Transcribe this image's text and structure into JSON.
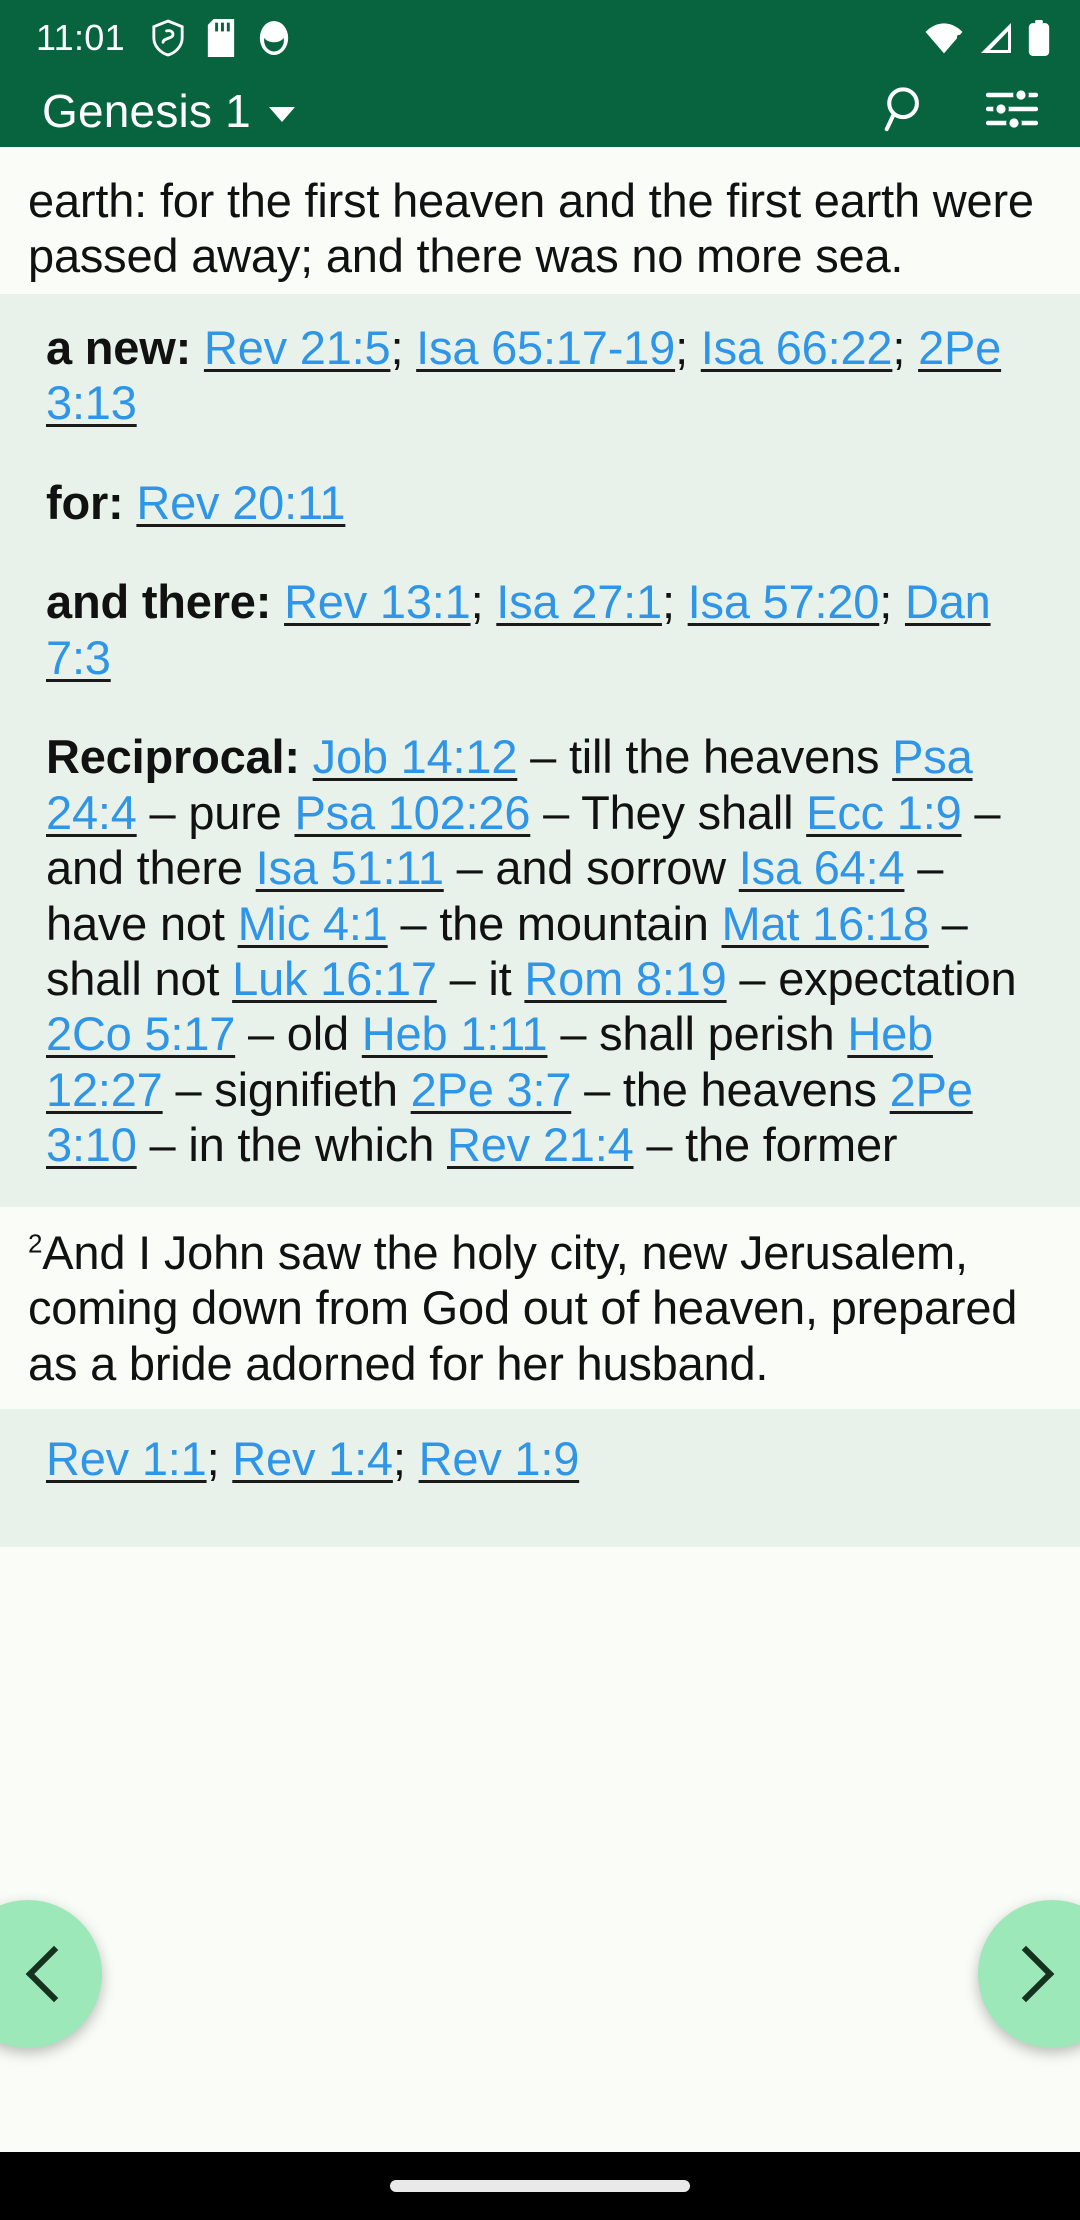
{
  "status_bar": {
    "time": "11:01",
    "left_icons": [
      "shield-vpn-icon",
      "sd-card-icon",
      "app-badge-icon"
    ],
    "right_icons": [
      "wifi-icon",
      "cellular-signal-icon",
      "battery-icon"
    ],
    "background_color": "#07643f",
    "foreground_color": "#ffffff"
  },
  "app_bar": {
    "title": "Genesis 1",
    "dropdown_icon": "chevron-down-icon",
    "search_icon": "search-icon",
    "settings_icon": "sliders-icon",
    "background_color": "#07643f"
  },
  "reader": {
    "verse_top": {
      "number": "",
      "text": "earth: for the first heaven and the first earth were passed away; and there was no more sea."
    },
    "verse_two": {
      "number": "2",
      "text": "And I John saw the holy city, new Jerusalem, coming down from God out of heaven, prepared as a bride adorned for her husband."
    }
  },
  "cross_references": {
    "panel_background": "#e8f2ea",
    "link_color": "#2f95e8",
    "groups": [
      {
        "label": "a new:",
        "refs": [
          "Rev 21:5",
          "Isa 65:17-19",
          "Isa 66:22",
          "2Pe 3:13"
        ]
      },
      {
        "label": "for:",
        "refs": [
          "Rev 20:11"
        ]
      },
      {
        "label": "and there:",
        "refs": [
          "Rev 13:1",
          "Isa 27:1",
          "Isa 57:20",
          "Dan 7:3"
        ]
      },
      {
        "label": "Reciprocal:",
        "entries": [
          {
            "ref": "Job 14:12",
            "note": "till the heavens"
          },
          {
            "ref": "Psa 24:4",
            "note": "pure"
          },
          {
            "ref": "Psa 102:26",
            "note": "They shall"
          },
          {
            "ref": "Ecc 1:9",
            "note": "and there"
          },
          {
            "ref": "Isa 51:11",
            "note": "and sorrow"
          },
          {
            "ref": "Isa 64:4",
            "note": "have not"
          },
          {
            "ref": "Mic 4:1",
            "note": "the mountain"
          },
          {
            "ref": "Mat 16:18",
            "note": "shall not"
          },
          {
            "ref": "Luk 16:17",
            "note": "it"
          },
          {
            "ref": "Rom 8:19",
            "note": "expectation"
          },
          {
            "ref": "2Co 5:17",
            "note": "old"
          },
          {
            "ref": "Heb 1:11",
            "note": "shall perish"
          },
          {
            "ref": "Heb 12:27",
            "note": "signifieth"
          },
          {
            "ref": "2Pe 3:7",
            "note": "the heavens"
          },
          {
            "ref": "2Pe 3:10",
            "note": "in the which"
          },
          {
            "ref": "Rev 21:4",
            "note": "the former"
          }
        ]
      }
    ],
    "bottom_partial_refs": [
      "Rev 1:1",
      "Rev 1:4",
      "Rev 1:9"
    ]
  },
  "floating_buttons": {
    "previous": {
      "icon": "chevron-left-icon",
      "color": "#9ce8b8"
    },
    "next": {
      "icon": "chevron-right-icon",
      "color": "#9ce8b8"
    }
  },
  "nav_bar": {
    "gesture_pill": "home-gesture-pill"
  }
}
